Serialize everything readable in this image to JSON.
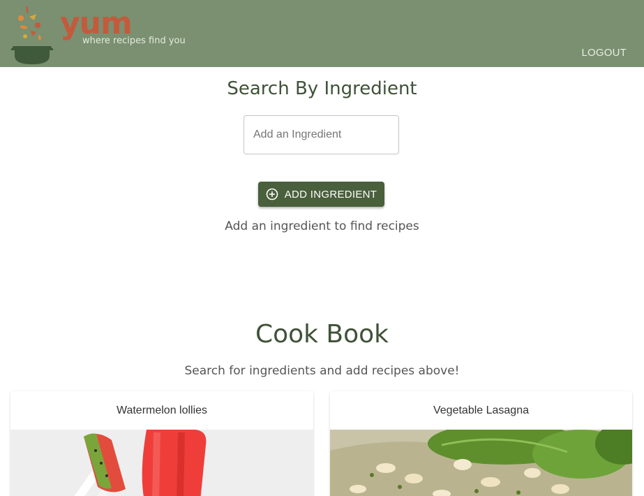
{
  "header": {
    "logo_word": "yum",
    "logo_tagline": "where recipes find you",
    "logout_label": "LOGOUT",
    "background_color": "#7a9070"
  },
  "search": {
    "title": "Search By Ingredient",
    "input_placeholder": "Add an Ingredient",
    "input_value": "",
    "add_button_label": "ADD INGREDIENT",
    "add_button_icon": "plus-circle-icon",
    "hint": "Add an ingredient to find recipes"
  },
  "cookbook": {
    "title": "Cook Book",
    "subtitle": "Search for ingredients and add recipes above!",
    "recipes": [
      {
        "title": "Watermelon lollies"
      },
      {
        "title": "Vegetable Lasagna"
      }
    ]
  },
  "colors": {
    "accent": "#4a5f3c",
    "heading": "#3f5238",
    "logo": "#c45a3c"
  }
}
